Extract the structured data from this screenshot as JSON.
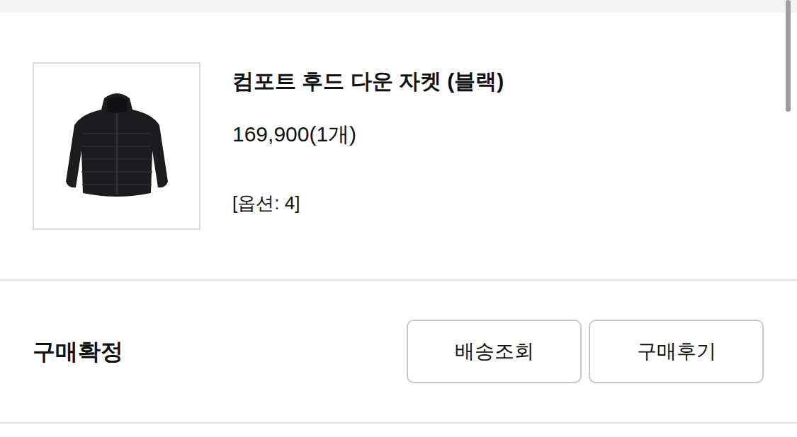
{
  "order_item": {
    "product_name": "컴포트 후드 다운 자켓 (블랙)",
    "price_quantity": "169,900(1개)",
    "option": "[옵션: 4]"
  },
  "status": "구매확정",
  "buttons": [
    "배송조회",
    "구매후기"
  ]
}
